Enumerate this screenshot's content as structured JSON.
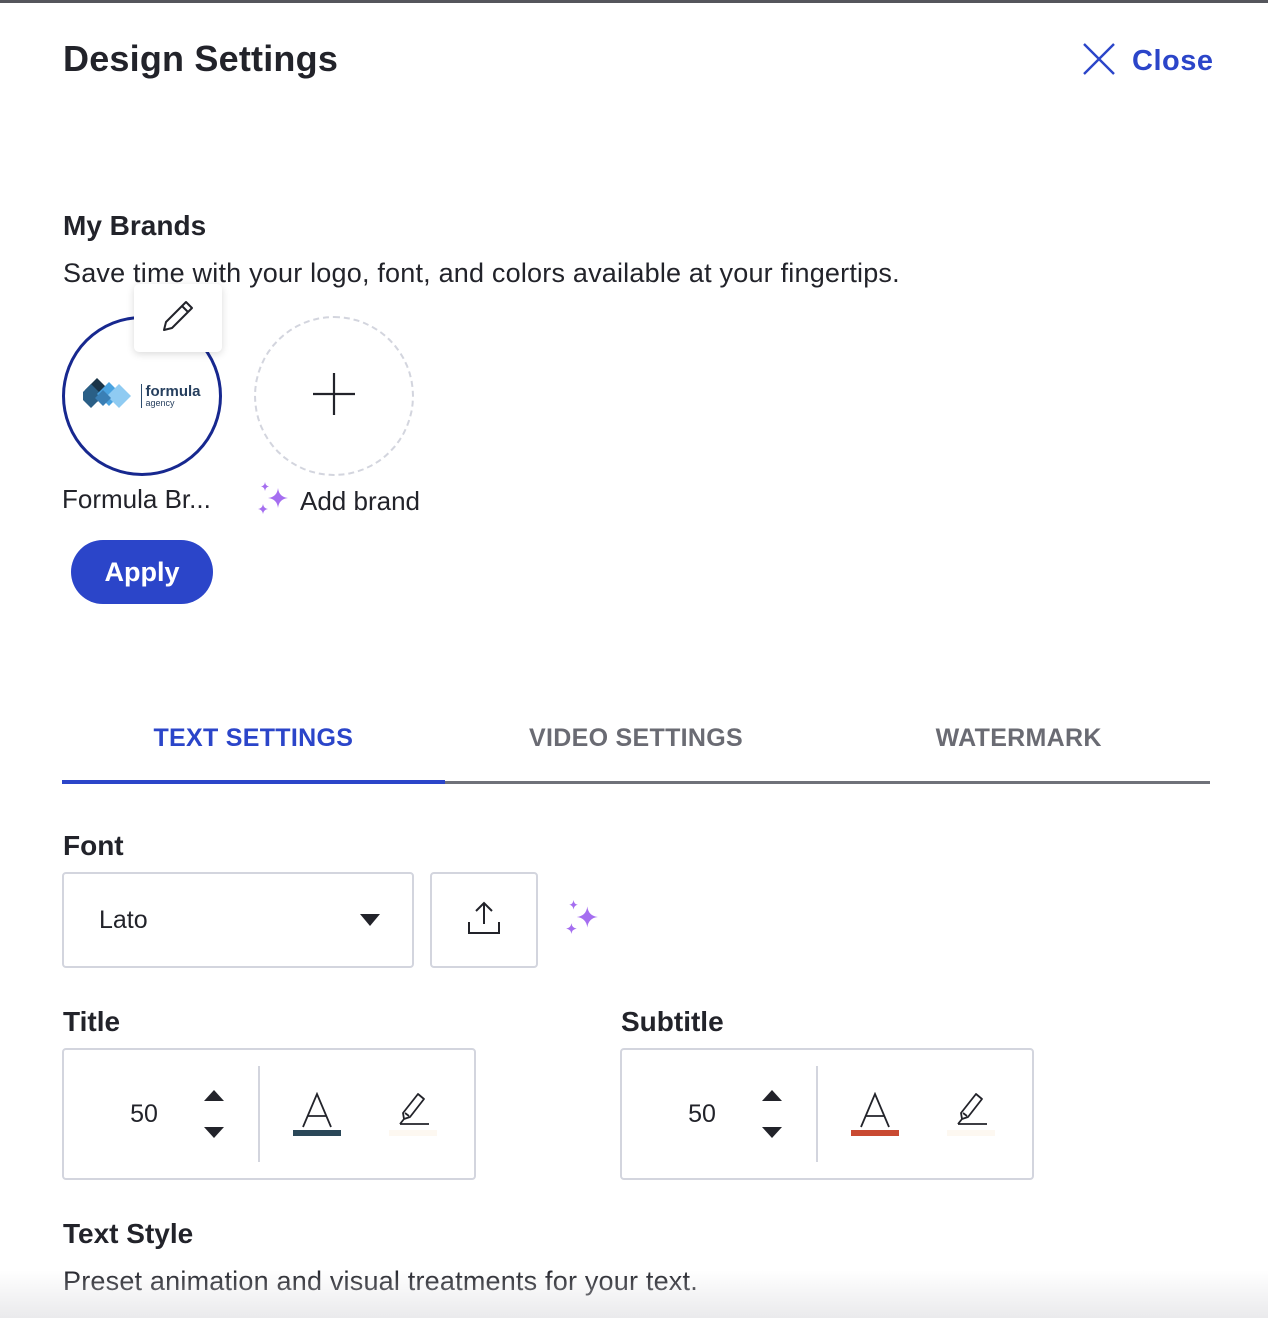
{
  "header": {
    "title": "Design Settings",
    "close_label": "Close",
    "close_icon": "close-x-icon"
  },
  "brands": {
    "heading": "My Brands",
    "description": "Save time with your logo, font, and colors available at your fingertips.",
    "items": [
      {
        "name": "Formula Br...",
        "logo_text": "formula",
        "logo_subtext": "agency",
        "selected": true,
        "edit_icon": "pencil-icon"
      }
    ],
    "add_brand_label": "Add brand",
    "add_icon": "plus-icon",
    "sparkle_icon": "sparkle-icon",
    "apply_label": "Apply"
  },
  "tabs": [
    {
      "label": "TEXT SETTINGS",
      "active": true
    },
    {
      "label": "VIDEO SETTINGS",
      "active": false
    },
    {
      "label": "WATERMARK",
      "active": false
    }
  ],
  "font": {
    "label": "Font",
    "selected": "Lato",
    "upload_icon": "upload-icon",
    "ai_icon": "sparkle-icon"
  },
  "title_settings": {
    "label": "Title",
    "size": "50",
    "text_color": "#2a4758",
    "highlight_color": "#fdf8f1"
  },
  "subtitle_settings": {
    "label": "Subtitle",
    "size": "50",
    "text_color": "#c94a32",
    "highlight_color": "#fdf8f1"
  },
  "text_style": {
    "heading": "Text Style",
    "description": "Preset animation and visual treatments for your text."
  },
  "colors": {
    "accent": "#2b45c9",
    "brand_ring": "#17288f",
    "sparkle": "#a56ef0",
    "text": "#22232a"
  }
}
